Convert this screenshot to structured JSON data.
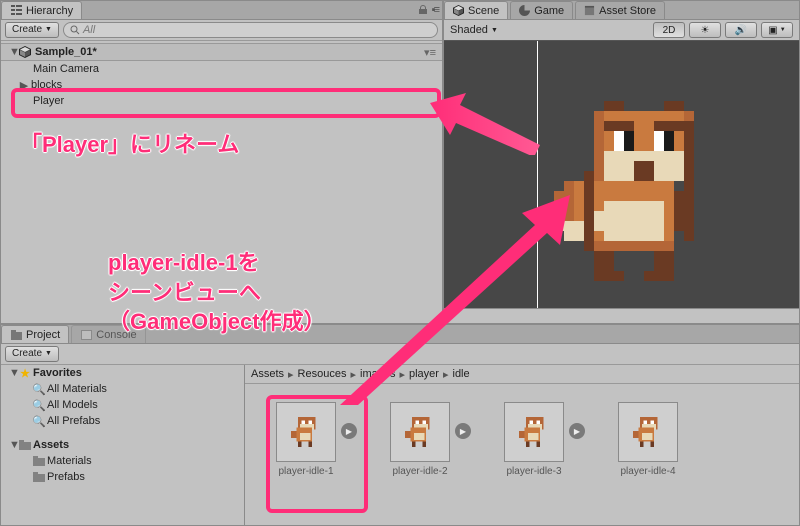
{
  "hierarchy": {
    "tab_label": "Hierarchy",
    "create_label": "Create",
    "search_placeholder": "All",
    "scene_name": "Sample_01*",
    "items": [
      {
        "label": "Main Camera",
        "expandable": false,
        "indent": 1
      },
      {
        "label": "blocks",
        "expandable": true,
        "indent": 1
      },
      {
        "label": "Player",
        "expandable": false,
        "indent": 1,
        "highlighted": true
      }
    ]
  },
  "scene": {
    "tabs": [
      {
        "label": "Scene",
        "active": true
      },
      {
        "label": "Game",
        "active": false
      },
      {
        "label": "Asset Store",
        "active": false
      }
    ],
    "shading_mode": "Shaded",
    "toolbar": {
      "mode_2d": "2D",
      "lighting_on": true,
      "audio_on": true,
      "fx_on": true
    }
  },
  "project": {
    "tabs": [
      {
        "label": "Project",
        "active": true
      },
      {
        "label": "Console",
        "active": false
      }
    ],
    "create_label": "Create",
    "favorites": {
      "heading": "Favorites",
      "items": [
        "All Materials",
        "All Models",
        "All Prefabs"
      ]
    },
    "assets": {
      "heading": "Assets",
      "items": [
        "Materials",
        "Prefabs"
      ]
    },
    "breadcrumbs": [
      "Assets",
      "Resouces",
      "images",
      "player",
      "idle"
    ],
    "grid_items": [
      {
        "name": "player-idle-1",
        "highlighted": true
      },
      {
        "name": "player-idle-2"
      },
      {
        "name": "player-idle-3"
      },
      {
        "name": "player-idle-4"
      }
    ]
  },
  "annotations": {
    "rename_text": "「Player」にリネーム",
    "drag_text_line1": "player-idle-1を",
    "drag_text_line2": "シーンビューへ",
    "drag_text_line3": "（GameObject作成）"
  }
}
